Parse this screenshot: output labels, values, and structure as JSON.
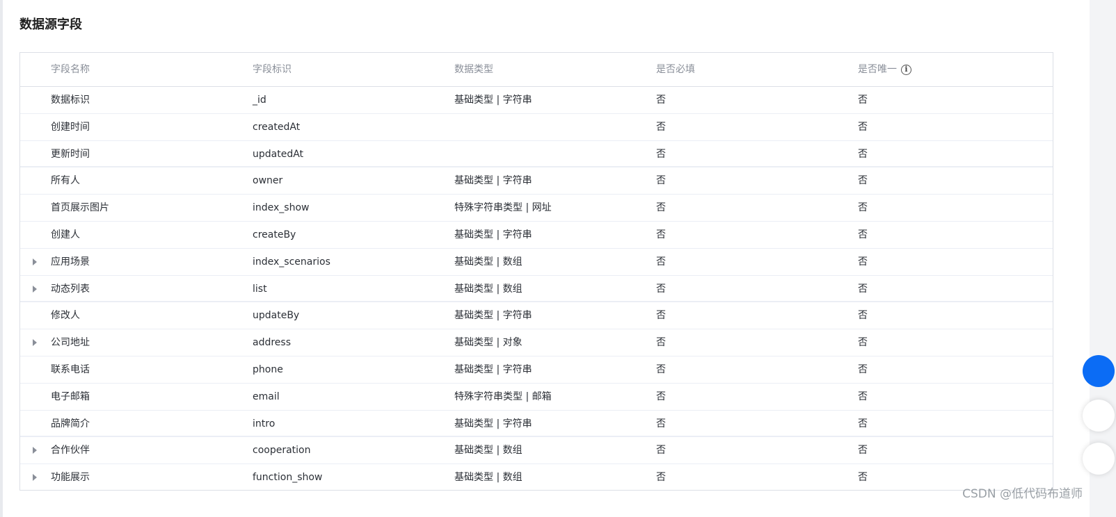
{
  "section": {
    "title": "数据源字段"
  },
  "table": {
    "headers": [
      "字段名称",
      "字段标识",
      "数据类型",
      "是否必填",
      "是否唯一"
    ],
    "rows": [
      {
        "name": "数据标识",
        "key": "_id",
        "type": "基础类型 | 字符串",
        "required": "否",
        "unique": "否",
        "expandable": false
      },
      {
        "name": "创建时间",
        "key": "createdAt",
        "type": "",
        "required": "否",
        "unique": "否",
        "expandable": false
      },
      {
        "name": "更新时间",
        "key": "updatedAt",
        "type": "",
        "required": "否",
        "unique": "否",
        "expandable": false
      },
      {
        "name": "所有人",
        "key": "owner",
        "type": "基础类型 | 字符串",
        "required": "否",
        "unique": "否",
        "expandable": false
      },
      {
        "name": "首页展示图片",
        "key": "index_show",
        "type": "特殊字符串类型 | 网址",
        "required": "否",
        "unique": "否",
        "expandable": false
      },
      {
        "name": "创建人",
        "key": "createBy",
        "type": "基础类型 | 字符串",
        "required": "否",
        "unique": "否",
        "expandable": false
      },
      {
        "name": "应用场景",
        "key": "index_scenarios",
        "type": "基础类型 | 数组",
        "required": "否",
        "unique": "否",
        "expandable": true
      },
      {
        "name": "动态列表",
        "key": "list",
        "type": "基础类型 | 数组",
        "required": "否",
        "unique": "否",
        "expandable": true
      },
      {
        "name": "修改人",
        "key": "updateBy",
        "type": "基础类型 | 字符串",
        "required": "否",
        "unique": "否",
        "expandable": false
      },
      {
        "name": "公司地址",
        "key": "address",
        "type": "基础类型 | 对象",
        "required": "否",
        "unique": "否",
        "expandable": true
      },
      {
        "name": "联系电话",
        "key": "phone",
        "type": "基础类型 | 字符串",
        "required": "否",
        "unique": "否",
        "expandable": false
      },
      {
        "name": "电子邮箱",
        "key": "email",
        "type": "特殊字符串类型 | 邮箱",
        "required": "否",
        "unique": "否",
        "expandable": false
      },
      {
        "name": "品牌简介",
        "key": "intro",
        "type": "基础类型 | 字符串",
        "required": "否",
        "unique": "否",
        "expandable": false
      },
      {
        "name": "合作伙伴",
        "key": "cooperation",
        "type": "基础类型 | 数组",
        "required": "否",
        "unique": "否",
        "expandable": true
      },
      {
        "name": "功能展示",
        "key": "function_show",
        "type": "基础类型 | 数组",
        "required": "否",
        "unique": "否",
        "expandable": true
      }
    ]
  },
  "icons": {
    "info": "info-circle-icon",
    "expand": "caret-right-icon"
  },
  "colors": {
    "accent": "#0b6cf5",
    "header_text": "#8a8f99",
    "body_text": "#2b2f36",
    "border": "#dcdfe6"
  },
  "watermark": "CSDN @低代码布道师"
}
